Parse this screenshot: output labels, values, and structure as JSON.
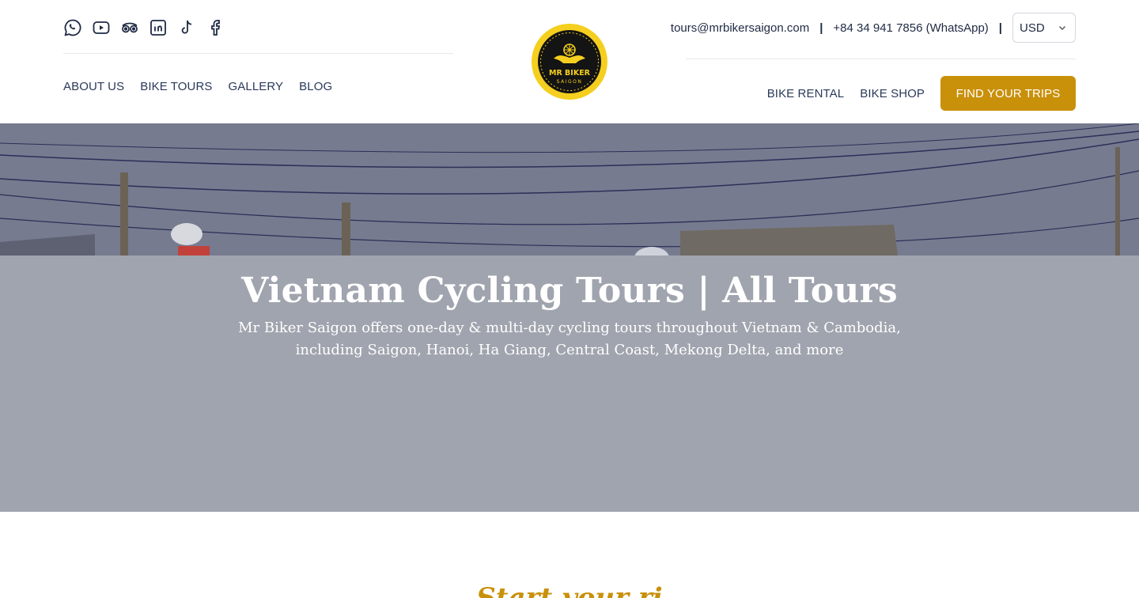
{
  "header": {
    "social": [
      {
        "icon": "whatsapp-icon",
        "label": "WhatsApp"
      },
      {
        "icon": "youtube-icon",
        "label": "YouTube"
      },
      {
        "icon": "tripadvisor-icon",
        "label": "Tripadvisor"
      },
      {
        "icon": "linkedin-icon",
        "label": "LinkedIn"
      },
      {
        "icon": "tiktok-icon",
        "label": "TikTok"
      },
      {
        "icon": "facebook-icon",
        "label": "Facebook"
      }
    ],
    "nav_left": [
      "ABOUT US",
      "BIKE TOURS",
      "GALLERY",
      "BLOG"
    ],
    "logo": {
      "text_main": "MR BIKER",
      "text_sub": "SAIGON"
    },
    "email": "tours@mrbikersaigon.com",
    "separator": "|",
    "phone": "+84 34 941 7856 (WhatsApp)",
    "currency": "USD",
    "nav_right": [
      "BIKE RENTAL",
      "BIKE SHOP"
    ],
    "cta_label": "FIND YOUR TRIPS"
  },
  "hero": {
    "title": "Vietnam Cycling Tours | All Tours",
    "subtitle": "Mr Biker Saigon offers one-day & multi-day cycling tours throughout Vietnam & Cambodia, including Saigon, Hanoi, Ha Giang, Central Coast, Mekong Delta, and more"
  },
  "section": {
    "heading_partial": "Start your ri"
  },
  "colors": {
    "accent": "#c9900a",
    "logo_yellow": "#f5cf1f",
    "nav_text": "#2a3a5a",
    "hero_overlay": "#a0a4ae"
  }
}
